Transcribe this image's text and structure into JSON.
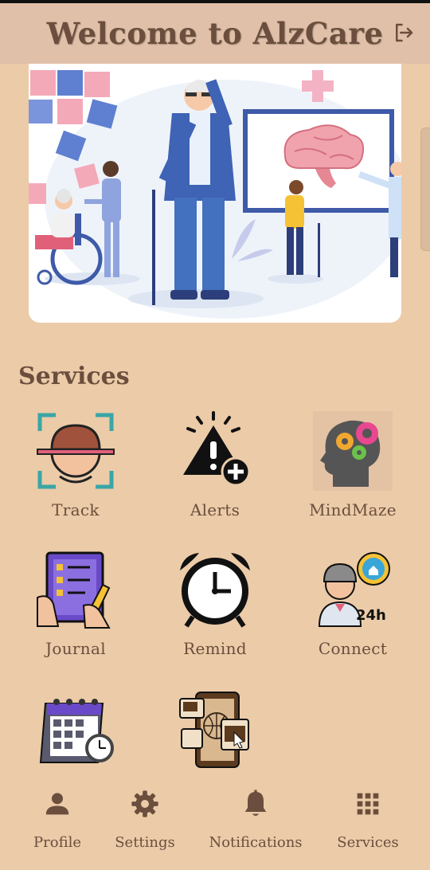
{
  "header": {
    "title": "Welcome to AlzCare",
    "logout_icon": "logout-icon"
  },
  "hero": {
    "image": "alzheimers-care-illustration"
  },
  "services": {
    "title": "Services",
    "items": [
      {
        "label": "Track",
        "icon": "face-scan-icon"
      },
      {
        "label": "Alerts",
        "icon": "alert-warning-icon"
      },
      {
        "label": "MindMaze",
        "icon": "brain-gears-icon"
      },
      {
        "label": "Journal",
        "icon": "checklist-journal-icon"
      },
      {
        "label": "Remind",
        "icon": "alarm-clock-icon"
      },
      {
        "label": "Connect",
        "icon": "support-agent-icon"
      },
      {
        "label": "",
        "icon": "calendar-clock-icon"
      },
      {
        "label": "",
        "icon": "web-devices-icon"
      }
    ]
  },
  "bottom_nav": {
    "items": [
      {
        "label": "Profile",
        "icon": "person-icon"
      },
      {
        "label": "Settings",
        "icon": "gear-icon"
      },
      {
        "label": "Notifications",
        "icon": "bell-icon"
      },
      {
        "label": "Services",
        "icon": "grid-icon"
      }
    ]
  },
  "colors": {
    "background": "#ebcba8",
    "header": "#e0c0a8",
    "text": "#6b4e3d"
  }
}
